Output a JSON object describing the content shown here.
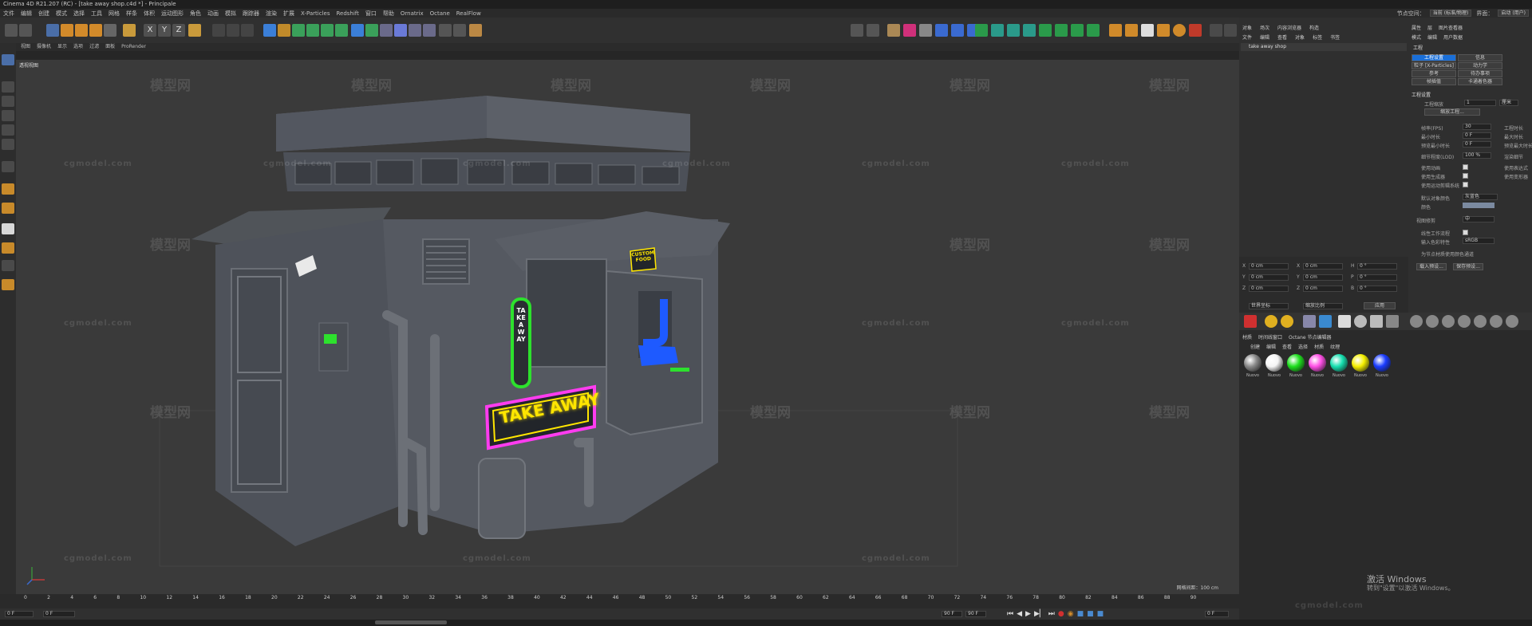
{
  "window": {
    "title": "Cinema 4D R21.207 (RC) - [take away shop.c4d *] - Principale"
  },
  "menu": {
    "items": [
      "文件",
      "编辑",
      "创建",
      "模式",
      "选择",
      "工具",
      "网格",
      "样条",
      "体积",
      "运动图形",
      "角色",
      "动画",
      "模拟",
      "跟踪器",
      "渲染",
      "扩展",
      "X-Particles",
      "Redshift",
      "窗口",
      "帮助",
      "Ornatrix",
      "Octane",
      "RealFlow"
    ],
    "layout_label": "节点空间：",
    "node_space": "当前 (标准/物理)",
    "interface_label": "界面：",
    "interface_value": "启动 (用户)"
  },
  "viewport": {
    "menu": [
      "视图",
      "摄像机",
      "显示",
      "选项",
      "过滤",
      "面板",
      "ProRender"
    ],
    "label": "透视视图",
    "grid_info": "网格间距：100 cm",
    "watermark_cn": "模型网",
    "watermark_en": "cgmodel.com"
  },
  "scene": {
    "sign_main": "TAKE AWAY",
    "sign_small": "CUSTOM FOOD",
    "sign_vertical": "TAKE AWAY"
  },
  "timeline": {
    "ticks": [
      "0",
      "2",
      "4",
      "6",
      "8",
      "10",
      "12",
      "14",
      "16",
      "18",
      "20",
      "22",
      "24",
      "26",
      "28",
      "30",
      "32",
      "34",
      "36",
      "38",
      "40",
      "42",
      "44",
      "46",
      "48",
      "50",
      "52",
      "54",
      "56",
      "58",
      "60",
      "62",
      "64",
      "66",
      "68",
      "70",
      "72",
      "74",
      "76",
      "78",
      "80",
      "82",
      "84",
      "86",
      "88",
      "90"
    ],
    "frame_current": "0 F",
    "start": "0 F",
    "end": "90 F",
    "end2": "90 F",
    "right_field": "0 F"
  },
  "object_manager": {
    "tabs": [
      "对象",
      "场次",
      "内容浏览器",
      "构造"
    ],
    "menu": [
      "文件",
      "编辑",
      "查看",
      "对象",
      "标签",
      "书签"
    ],
    "object": "take away shop"
  },
  "attributes": {
    "tabs": [
      "属性",
      "层",
      "图片查看器"
    ],
    "menu": [
      "模式",
      "编辑",
      "用户数据"
    ],
    "title": "工程",
    "subtabs": [
      "工程设置",
      "信息",
      "粒子 [X-Particles]",
      "动力学",
      "参考",
      "待办事项",
      "帧插值",
      "卡通着色器"
    ],
    "section": "工程设置",
    "fields": [
      {
        "label": "工程缩放",
        "value": "1",
        "unit": "厘米"
      },
      {
        "label": "缩放工程...",
        "value": ""
      },
      {
        "label": "帧率(FPS)",
        "value": "30"
      },
      {
        "label": "最小时长",
        "value": "0 F"
      },
      {
        "label": "预览最小时长",
        "value": "0 F"
      },
      {
        "label": "细节程度(LOD)",
        "value": "100 %"
      }
    ],
    "right_labels": [
      "工程时长",
      "最大时长",
      "预览最大时长",
      "渲染细节"
    ],
    "checks": [
      "使用动画",
      "使用生成器",
      "使用运动剪辑系统"
    ],
    "checks_right": [
      "使用表达式",
      "使用变形器"
    ],
    "default_color_label": "默认对象颜色",
    "default_color": "灰蓝色",
    "color_label": "颜色",
    "view_clip_label": "视图修剪",
    "view_clip": "中",
    "linear_label": "线性工作流程",
    "input_color_label": "输入色彩特性",
    "input_color": "sRGB",
    "node_material_label": "为节点材质使用颜色通道",
    "buttons": [
      "载入预设...",
      "保存预设..."
    ]
  },
  "coords": {
    "rows": [
      [
        "X",
        "0 cm",
        "X",
        "0 cm",
        "H",
        "0 °"
      ],
      [
        "Y",
        "0 cm",
        "Y",
        "0 cm",
        "P",
        "0 °"
      ],
      [
        "Z",
        "0 cm",
        "Z",
        "0 cm",
        "B",
        "0 °"
      ]
    ],
    "mode": "世界坐标",
    "size_mode": "缩放比例",
    "apply": "应用"
  },
  "material_manager": {
    "tabs": [
      "材质",
      "时间线窗口",
      "Octane 节点编辑器"
    ],
    "menu": [
      "创建",
      "编辑",
      "查看",
      "选择",
      "材质",
      "纹理"
    ],
    "materials": [
      {
        "name": "Nuovo",
        "color": "#8a8a8a"
      },
      {
        "name": "Nuovo",
        "color": "#f4f4f4"
      },
      {
        "name": "Nuovo",
        "color": "#1ee01e"
      },
      {
        "name": "Nuovo",
        "color": "#ff4fe6"
      },
      {
        "name": "Nuovo",
        "color": "#16e0b0"
      },
      {
        "name": "Nuovo",
        "color": "#f5f000"
      },
      {
        "name": "Nuovo",
        "color": "#1a3cff"
      }
    ]
  },
  "activation": {
    "line1": "激活 Windows",
    "line2": "转到\"设置\"以激活 Windows。"
  },
  "colors": {
    "neon_yellow": "#ffe600",
    "neon_pink": "#ff3cf0",
    "neon_green": "#2de12d",
    "screen_blue": "#1e5aff",
    "accent_blue": "#1a6fd8"
  }
}
